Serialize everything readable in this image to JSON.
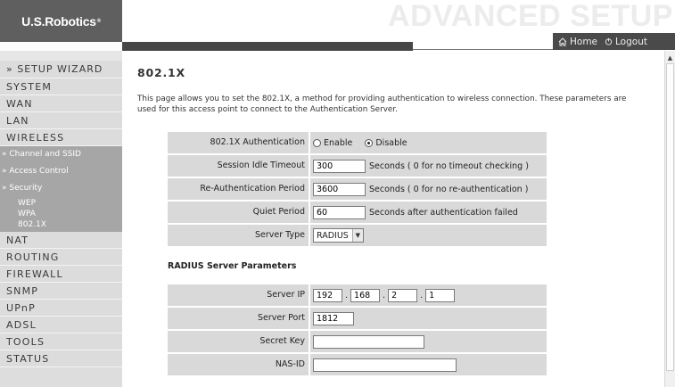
{
  "header": {
    "brand": "U.S.Robotics",
    "brand_tm": "®",
    "banner": "ADVANCED SETUP",
    "home_label": "Home",
    "logout_label": "Logout"
  },
  "sidebar": {
    "wizard": "» SETUP WIZARD",
    "system": "SYSTEM",
    "wan": "WAN",
    "lan": "LAN",
    "wireless": "WIRELESS",
    "channel_ssid": "» Channel and SSID",
    "access_control": "» Access Control",
    "security": "» Security",
    "wep": "WEP",
    "wpa": "WPA",
    "dot1x": "802.1X",
    "nat": "NAT",
    "routing": "ROUTING",
    "firewall": "FIREWALL",
    "snmp": "SNMP",
    "upnp": "UPnP",
    "adsl": "ADSL",
    "tools": "TOOLS",
    "status": "STATUS"
  },
  "main": {
    "title": "802.1X",
    "description": "This page allows you to set the 802.1X, a method for providing authentication to wireless connection.  These parameters are used for this access point to connect to the Authentication Server.",
    "auth_label": "802.1X Authentication",
    "enable_label": "Enable",
    "disable_label": "Disable",
    "session_label": "Session Idle Timeout",
    "session_value": "300",
    "session_hint": "Seconds ( 0 for no timeout checking )",
    "reauth_label": "Re-Authentication Period",
    "reauth_value": "3600",
    "reauth_hint": "Seconds ( 0 for no re-authentication )",
    "quiet_label": "Quiet Period",
    "quiet_value": "60",
    "quiet_hint": "Seconds after authentication failed",
    "server_type_label": "Server Type",
    "server_type_value": "RADIUS",
    "radius_title": "RADIUS Server Parameters",
    "server_ip_label": "Server IP",
    "ip1": "192",
    "ip2": "168",
    "ip3": "2",
    "ip4": "1",
    "ip_sep": ".",
    "server_port_label": "Server Port",
    "server_port_value": "1812",
    "secret_key_label": "Secret Key",
    "secret_key_value": "",
    "nas_id_label": "NAS-ID",
    "nas_id_value": ""
  },
  "icons": {
    "home": "home-icon",
    "logout": "power-icon",
    "scroll_up": "chevron-up-icon",
    "select_arrow": "chevron-down-icon"
  }
}
